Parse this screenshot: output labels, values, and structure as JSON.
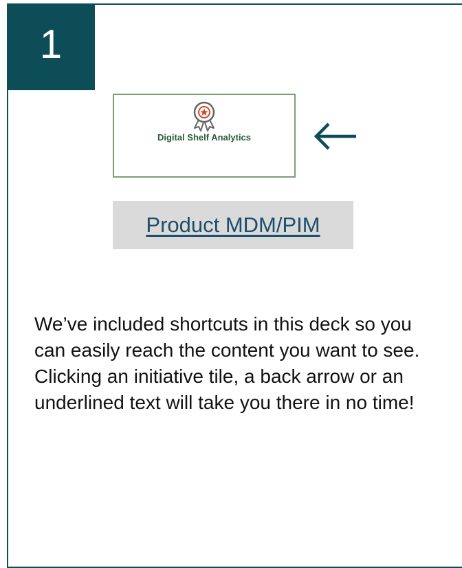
{
  "step": {
    "number": "1"
  },
  "tile": {
    "label": "Digital Shelf Analytics",
    "icon": "award-ribbon-icon"
  },
  "arrow": {
    "icon": "back-arrow-icon"
  },
  "link": {
    "text": "Product MDM/PIM"
  },
  "info": {
    "text": "We’ve included shortcuts in this deck so you can easily reach the content you want to see. Clicking an initiative tile, a back arrow or an underlined text will take you there in no time!"
  },
  "colors": {
    "accent": "#0d4d57",
    "tile_border": "#7f9e72",
    "link": "#1c4f6b"
  }
}
